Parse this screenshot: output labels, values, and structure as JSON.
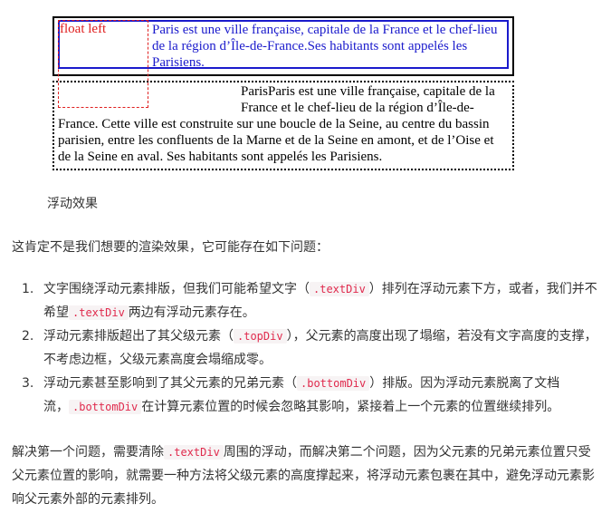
{
  "demo": {
    "float_label": "float left",
    "text_div_content": "Paris est une ville française, capitale de la France et le chef-lieu de la région d’Île-de-France.Ses habitants sont appelés les Parisiens.",
    "bottom_div_content": "ParisParis est une ville française, capitale de la France et le chef-lieu de la région d’Île-de-France. Cette ville est construite sur une boucle de la Seine, au centre du bassin parisien, entre les confluents de la Marne et de la Seine en amont, et de l’Oise et de la Seine en aval. Ses habitants sont appelés les Parisiens."
  },
  "caption": "浮动效果",
  "intro": "这肯定不是我们想要的渲染效果，它可能存在如下问题：",
  "issues": [
    {
      "num": "1.",
      "a": "文字围绕浮动元素排版，但我们可能希望文字（",
      "code1": ".textDiv",
      "b": "）排列在浮动元素下方，或者，我们并不希望",
      "code2": ".textDiv",
      "c": "两边有浮动元素存在。"
    },
    {
      "num": "2.",
      "a": "浮动元素排版超出了其父级元素（",
      "code1": ".topDiv",
      "b": "），父元素的高度出现了塌缩，若没有文字高度的支撑，不考虑边框，父级元素高度会塌缩成零。"
    },
    {
      "num": "3.",
      "a": "浮动元素甚至影响到了其父元素的兄弟元素（",
      "code1": ".bottomDiv",
      "b": "）排版。因为浮动元素脱离了文档流，",
      "code2": ".bottomDiv",
      "c": "在计算元素位置的时候会忽略其影响，紧接着上一个元素的位置继续排列。"
    }
  ],
  "solution": {
    "a": "解决第一个问题，需要清除",
    "code": ".textDiv",
    "b": "周围的浮动，而解决第二个问题，因为父元素的兄弟元素位置只受父元素位置的影响，就需要一种方法将父级元素的高度撑起来，将浮动元素包裹在其中，避免浮动元素影响父元素外部的元素排列。"
  }
}
